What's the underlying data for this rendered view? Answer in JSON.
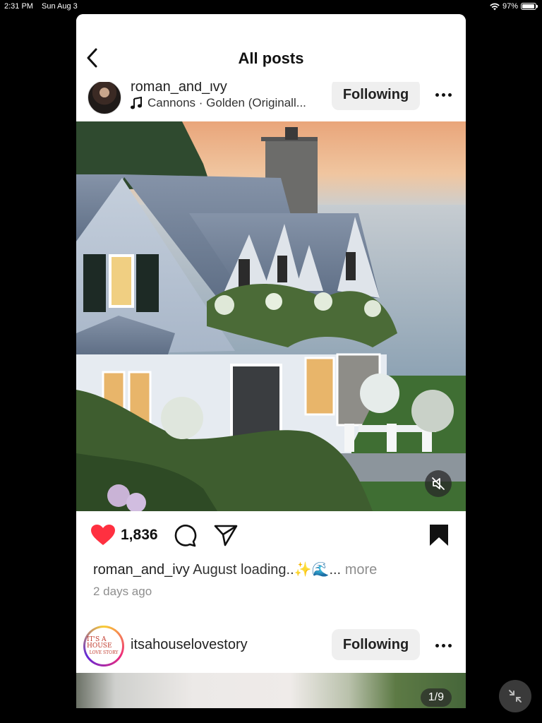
{
  "status_bar": {
    "time": "2:31 PM",
    "date": "Sun Aug 3",
    "battery": "97%",
    "battery_level": 0.97
  },
  "header": {
    "title": "All posts",
    "back_icon": "chevron-left-icon"
  },
  "post1": {
    "username": "roman_and_ivy",
    "audio": "Cannons · Golden (Originall...",
    "follow_label": "Following",
    "likes": "1,836",
    "caption_user": "roman_and_ivy",
    "caption_text": "August loading..✨🌊...",
    "caption_more": "more",
    "time_ago": "2 days ago",
    "liked": true,
    "saved": true
  },
  "post2": {
    "username": "itsahouselovestory",
    "follow_label": "Following",
    "avatar_line1": "IT'S A HOUSE",
    "avatar_line2": "LOVE STORY",
    "page_count": "1/9"
  },
  "colors": {
    "like_red": "#ff3040",
    "button_gray": "#efefef",
    "muted_text": "#8e8e8e"
  }
}
